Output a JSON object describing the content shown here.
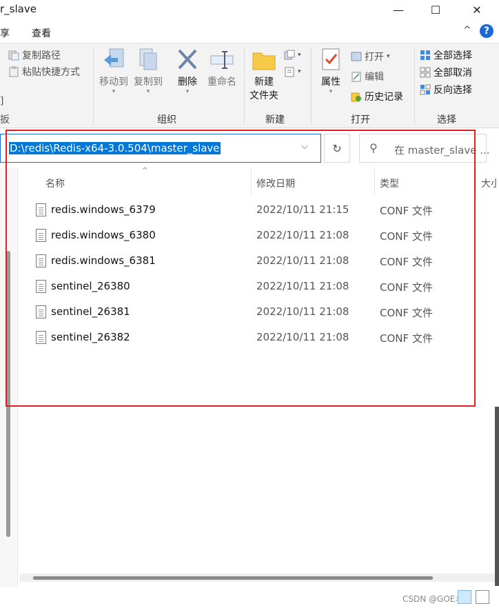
{
  "window": {
    "title": "r_slave",
    "minimize": "—",
    "maximize": "☐",
    "close": "✕"
  },
  "menu": {
    "share": "享",
    "view": "查看",
    "collapse": "^",
    "help": "?"
  },
  "ribbon": {
    "copy_path": "复制路径",
    "paste_shortcut": "粘贴快捷方式",
    "left_frag_1": "]",
    "left_frag_2": "扳",
    "move_to": "移动到",
    "copy_to": "复制到",
    "delete": "删除",
    "rename": "重命名",
    "organize": "组织",
    "new_folder_line1": "新建",
    "new_folder_line2": "文件夹",
    "new_group": "新建",
    "properties": "属性",
    "open": "打开",
    "edit": "编辑",
    "history": "历史记录",
    "open_group": "打开",
    "select_all": "全部选择",
    "select_none": "全部取消",
    "invert_selection": "反向选择",
    "select_group": "选择"
  },
  "address": {
    "path": "D:\\redis\\Redis-x64-3.0.504\\master_slave",
    "search_placeholder": "在 master_slave ..."
  },
  "columns": {
    "name": "名称",
    "date": "修改日期",
    "type": "类型",
    "size": "大小"
  },
  "files": [
    {
      "name": "redis.windows_6379",
      "date": "2022/10/11 21:15",
      "type": "CONF 文件"
    },
    {
      "name": "redis.windows_6380",
      "date": "2022/10/11 21:08",
      "type": "CONF 文件"
    },
    {
      "name": "redis.windows_6381",
      "date": "2022/10/11 21:08",
      "type": "CONF 文件"
    },
    {
      "name": "sentinel_26380",
      "date": "2022/10/11 21:08",
      "type": "CONF 文件"
    },
    {
      "name": "sentinel_26381",
      "date": "2022/10/11 21:08",
      "type": "CONF 文件"
    },
    {
      "name": "sentinel_26382",
      "date": "2022/10/11 21:08",
      "type": "CONF 文件"
    }
  ],
  "watermark": "CSDN @GOE斗帅",
  "colors": {
    "accent": "#0078d7",
    "highlight_box": "#e02020"
  }
}
